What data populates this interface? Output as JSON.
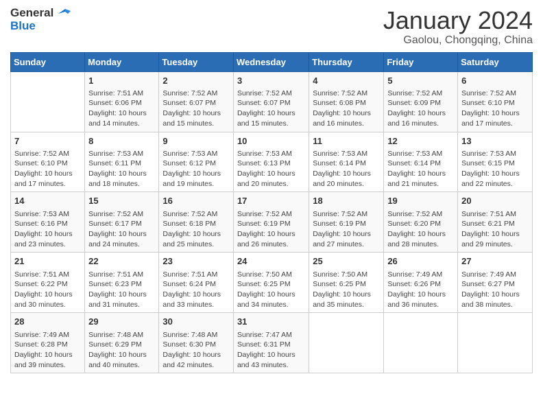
{
  "header": {
    "logo_line1": "General",
    "logo_line2": "Blue",
    "title": "January 2024",
    "subtitle": "Gaolou, Chongqing, China"
  },
  "columns": [
    "Sunday",
    "Monday",
    "Tuesday",
    "Wednesday",
    "Thursday",
    "Friday",
    "Saturday"
  ],
  "weeks": [
    [
      {
        "num": "",
        "info": ""
      },
      {
        "num": "1",
        "info": "Sunrise: 7:51 AM\nSunset: 6:06 PM\nDaylight: 10 hours\nand 14 minutes."
      },
      {
        "num": "2",
        "info": "Sunrise: 7:52 AM\nSunset: 6:07 PM\nDaylight: 10 hours\nand 15 minutes."
      },
      {
        "num": "3",
        "info": "Sunrise: 7:52 AM\nSunset: 6:07 PM\nDaylight: 10 hours\nand 15 minutes."
      },
      {
        "num": "4",
        "info": "Sunrise: 7:52 AM\nSunset: 6:08 PM\nDaylight: 10 hours\nand 16 minutes."
      },
      {
        "num": "5",
        "info": "Sunrise: 7:52 AM\nSunset: 6:09 PM\nDaylight: 10 hours\nand 16 minutes."
      },
      {
        "num": "6",
        "info": "Sunrise: 7:52 AM\nSunset: 6:10 PM\nDaylight: 10 hours\nand 17 minutes."
      }
    ],
    [
      {
        "num": "7",
        "info": "Sunrise: 7:52 AM\nSunset: 6:10 PM\nDaylight: 10 hours\nand 17 minutes."
      },
      {
        "num": "8",
        "info": "Sunrise: 7:53 AM\nSunset: 6:11 PM\nDaylight: 10 hours\nand 18 minutes."
      },
      {
        "num": "9",
        "info": "Sunrise: 7:53 AM\nSunset: 6:12 PM\nDaylight: 10 hours\nand 19 minutes."
      },
      {
        "num": "10",
        "info": "Sunrise: 7:53 AM\nSunset: 6:13 PM\nDaylight: 10 hours\nand 20 minutes."
      },
      {
        "num": "11",
        "info": "Sunrise: 7:53 AM\nSunset: 6:14 PM\nDaylight: 10 hours\nand 20 minutes."
      },
      {
        "num": "12",
        "info": "Sunrise: 7:53 AM\nSunset: 6:14 PM\nDaylight: 10 hours\nand 21 minutes."
      },
      {
        "num": "13",
        "info": "Sunrise: 7:53 AM\nSunset: 6:15 PM\nDaylight: 10 hours\nand 22 minutes."
      }
    ],
    [
      {
        "num": "14",
        "info": "Sunrise: 7:53 AM\nSunset: 6:16 PM\nDaylight: 10 hours\nand 23 minutes."
      },
      {
        "num": "15",
        "info": "Sunrise: 7:52 AM\nSunset: 6:17 PM\nDaylight: 10 hours\nand 24 minutes."
      },
      {
        "num": "16",
        "info": "Sunrise: 7:52 AM\nSunset: 6:18 PM\nDaylight: 10 hours\nand 25 minutes."
      },
      {
        "num": "17",
        "info": "Sunrise: 7:52 AM\nSunset: 6:19 PM\nDaylight: 10 hours\nand 26 minutes."
      },
      {
        "num": "18",
        "info": "Sunrise: 7:52 AM\nSunset: 6:19 PM\nDaylight: 10 hours\nand 27 minutes."
      },
      {
        "num": "19",
        "info": "Sunrise: 7:52 AM\nSunset: 6:20 PM\nDaylight: 10 hours\nand 28 minutes."
      },
      {
        "num": "20",
        "info": "Sunrise: 7:51 AM\nSunset: 6:21 PM\nDaylight: 10 hours\nand 29 minutes."
      }
    ],
    [
      {
        "num": "21",
        "info": "Sunrise: 7:51 AM\nSunset: 6:22 PM\nDaylight: 10 hours\nand 30 minutes."
      },
      {
        "num": "22",
        "info": "Sunrise: 7:51 AM\nSunset: 6:23 PM\nDaylight: 10 hours\nand 31 minutes."
      },
      {
        "num": "23",
        "info": "Sunrise: 7:51 AM\nSunset: 6:24 PM\nDaylight: 10 hours\nand 33 minutes."
      },
      {
        "num": "24",
        "info": "Sunrise: 7:50 AM\nSunset: 6:25 PM\nDaylight: 10 hours\nand 34 minutes."
      },
      {
        "num": "25",
        "info": "Sunrise: 7:50 AM\nSunset: 6:25 PM\nDaylight: 10 hours\nand 35 minutes."
      },
      {
        "num": "26",
        "info": "Sunrise: 7:49 AM\nSunset: 6:26 PM\nDaylight: 10 hours\nand 36 minutes."
      },
      {
        "num": "27",
        "info": "Sunrise: 7:49 AM\nSunset: 6:27 PM\nDaylight: 10 hours\nand 38 minutes."
      }
    ],
    [
      {
        "num": "28",
        "info": "Sunrise: 7:49 AM\nSunset: 6:28 PM\nDaylight: 10 hours\nand 39 minutes."
      },
      {
        "num": "29",
        "info": "Sunrise: 7:48 AM\nSunset: 6:29 PM\nDaylight: 10 hours\nand 40 minutes."
      },
      {
        "num": "30",
        "info": "Sunrise: 7:48 AM\nSunset: 6:30 PM\nDaylight: 10 hours\nand 42 minutes."
      },
      {
        "num": "31",
        "info": "Sunrise: 7:47 AM\nSunset: 6:31 PM\nDaylight: 10 hours\nand 43 minutes."
      },
      {
        "num": "",
        "info": ""
      },
      {
        "num": "",
        "info": ""
      },
      {
        "num": "",
        "info": ""
      }
    ]
  ]
}
